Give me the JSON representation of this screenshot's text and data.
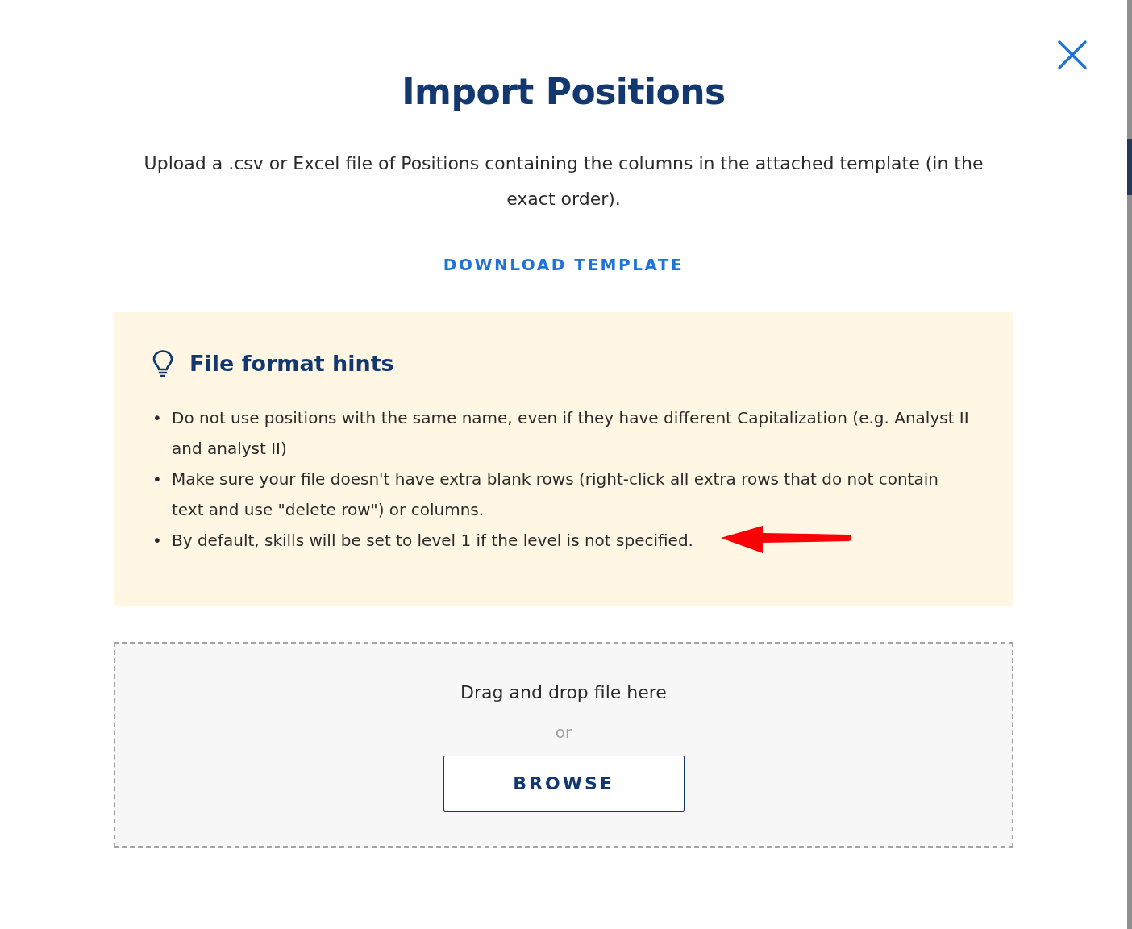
{
  "dialog": {
    "title": "Import Positions",
    "description": "Upload a .csv or Excel file of Positions containing the columns in the attached template (in the exact order).",
    "template_link": "DOWNLOAD TEMPLATE"
  },
  "hints": {
    "title": "File format hints",
    "items": [
      {
        "bullet": "•",
        "text": "Do not use positions with the same name, even if they have different Capitalization (e.g. Analyst II and analyst II)",
        "annotated": false
      },
      {
        "bullet": "•",
        "text": "Make sure your file doesn't have extra blank rows (right-click all extra rows that do not contain text and use \"delete row\") or columns.",
        "annotated": false
      },
      {
        "bullet": "•",
        "text": "By default, skills will be set to level 1 if the level is not specified.",
        "annotated": true
      }
    ]
  },
  "dropzone": {
    "prompt": "Drag and drop file here",
    "separator": "or",
    "button": "BROWSE"
  }
}
